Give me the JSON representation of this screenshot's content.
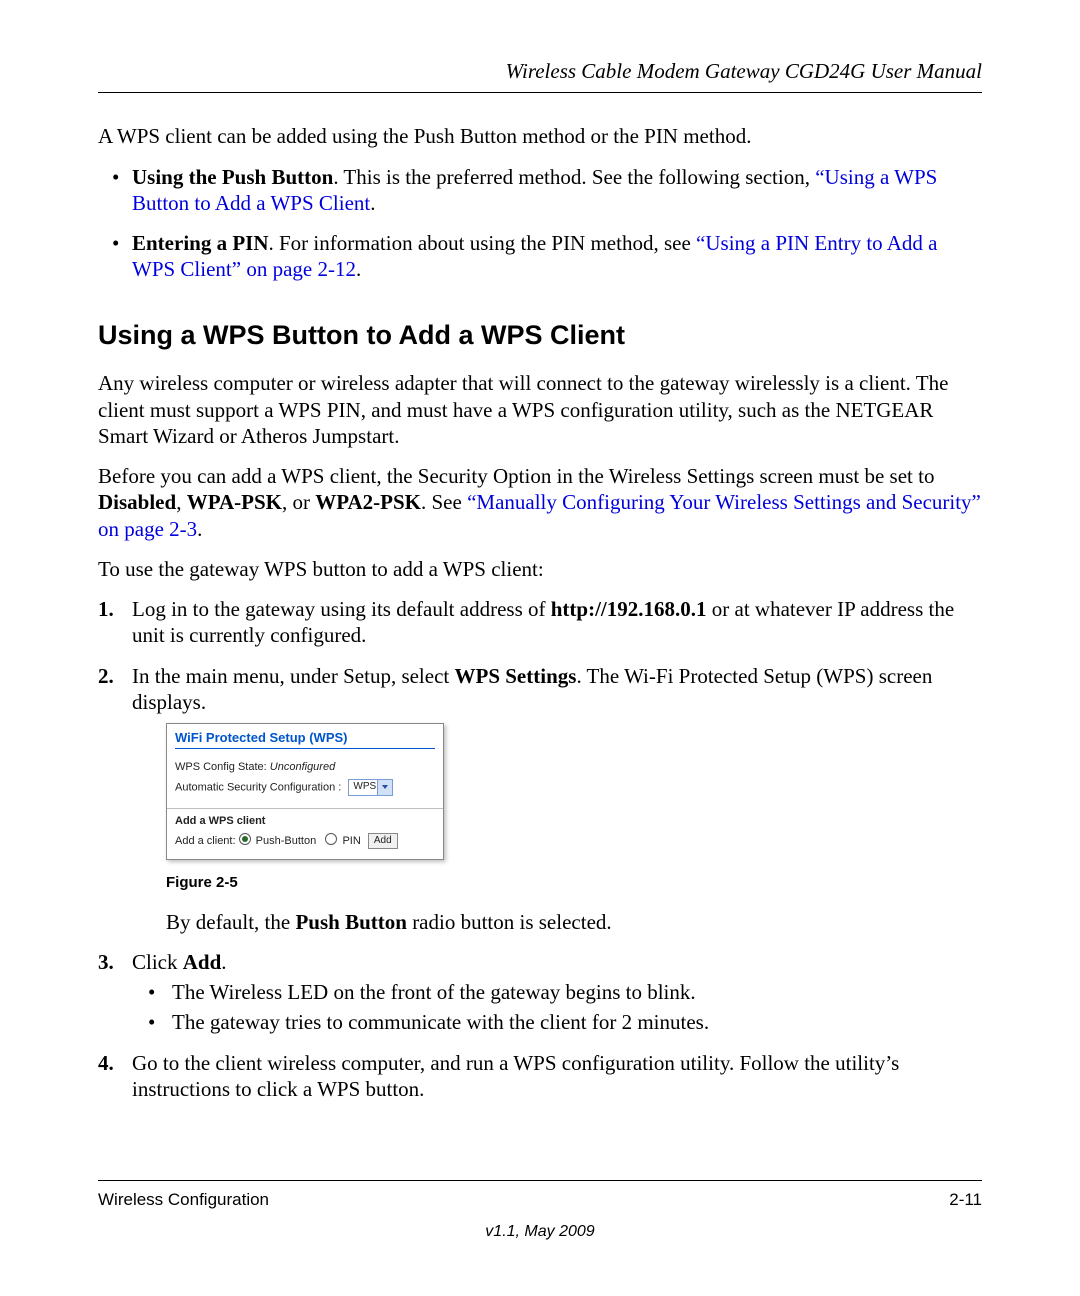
{
  "header": {
    "title": "Wireless Cable Modem Gateway CGD24G User Manual"
  },
  "intro": {
    "p1": "A WPS client can be added using the Push Button method or the PIN method."
  },
  "bullet1": {
    "lead": "Using the Push Button",
    "text_before_link": ". This is the preferred method. See the following section, ",
    "link": "“Using a WPS Button to Add a WPS Client",
    "text_after_link": "."
  },
  "bullet2": {
    "lead": "Entering a PIN",
    "text_before_link": ". For information about using the PIN method, see ",
    "link": "“Using a PIN Entry to Add a WPS Client” on page 2-12",
    "text_after_link": "."
  },
  "heading": "Using a WPS Button to Add a WPS Client",
  "para1": "Any wireless computer or wireless adapter that will connect to the gateway wirelessly is a client. The client must support a WPS PIN, and must have a WPS configuration utility, such as the NETGEAR Smart Wizard or Atheros Jumpstart.",
  "para2": {
    "before": "Before you can add a WPS client, the Security Option in the Wireless Settings screen must be set to ",
    "b1": "Disabled",
    "sep1": ", ",
    "b2": "WPA-PSK",
    "sep2": ", or ",
    "b3": "WPA2-PSK",
    "after_b": ". See ",
    "link": "“Manually Configuring Your Wireless Settings and Security” on page 2-3",
    "tail": "."
  },
  "para3": "To use the gateway WPS button to add a WPS client:",
  "step1": {
    "before": "Log in to the gateway using its default address of ",
    "bold": "http://192.168.0.1",
    "after": " or at whatever IP address the unit is currently configured."
  },
  "step2": {
    "before": "In the main menu, under Setup, select ",
    "bold": "WPS Settings",
    "after": ". The Wi-Fi Protected Setup (WPS) screen displays."
  },
  "wps_panel": {
    "title": "WiFi Protected Setup (WPS)",
    "state_label": "WPS Config State: ",
    "state_value": "Unconfigured",
    "asc_label": "Automatic Security Configuration :",
    "asc_value": "WPS",
    "sub_heading": "Add a WPS client",
    "add_label": "Add a client:",
    "opt_push": "Push-Button",
    "opt_pin": "PIN",
    "add_btn": "Add"
  },
  "figure_caption": "Figure 2-5",
  "after_figure": {
    "before": "By default, the ",
    "bold": "Push Button",
    "after": " radio button is selected."
  },
  "step3": {
    "before": "Click ",
    "bold": "Add",
    "after": ".",
    "sub1": "The Wireless LED on the front of the gateway begins to blink.",
    "sub2": "The gateway tries to communicate with the client for 2 minutes."
  },
  "step4": "Go to the client wireless computer, and run a WPS configuration utility. Follow the utility’s instructions to click a WPS button.",
  "footer": {
    "left": "Wireless Configuration",
    "right": "2-11",
    "version": "v1.1, May 2009"
  }
}
